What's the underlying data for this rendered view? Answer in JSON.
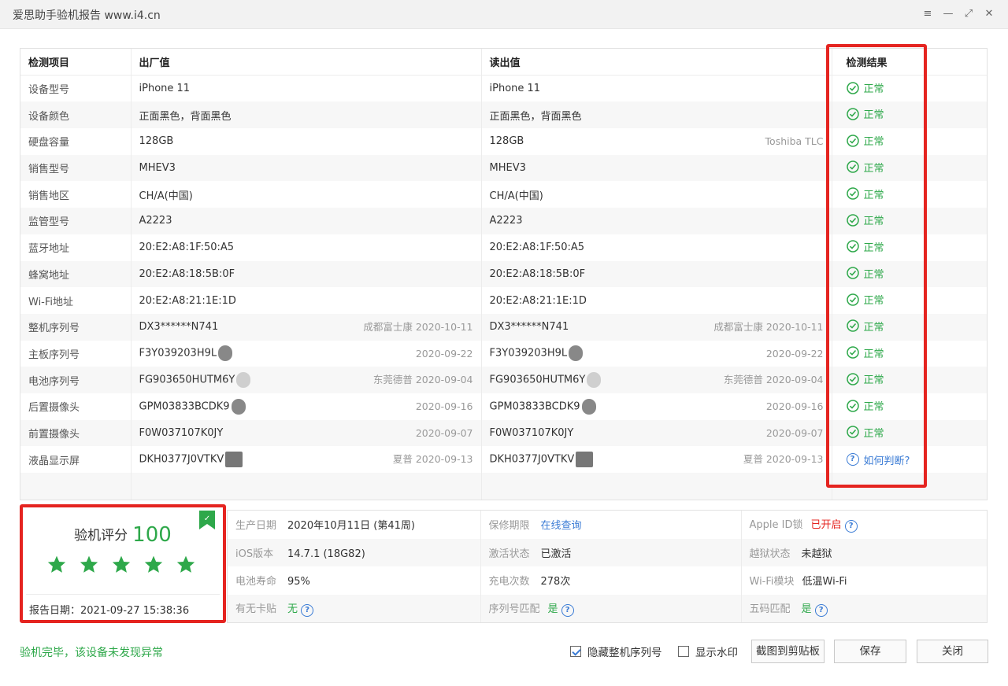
{
  "window": {
    "title": "爱思助手验机报告 www.i4.cn",
    "controls": [
      "≡",
      "—",
      "⤢",
      "✕"
    ]
  },
  "table": {
    "headers": {
      "item": "检测项目",
      "factory": "出厂值",
      "read": "读出值",
      "result": "检测结果"
    },
    "rows": [
      {
        "item": "设备型号",
        "factory": "iPhone 11",
        "factory_note": "",
        "read": "iPhone 11",
        "read_note": "",
        "result": "正常"
      },
      {
        "item": "设备颜色",
        "factory": "正面黑色，背面黑色",
        "factory_note": "",
        "read": "正面黑色，背面黑色",
        "read_note": "",
        "result": "正常"
      },
      {
        "item": "硬盘容量",
        "factory": "128GB",
        "factory_note": "",
        "read": "128GB",
        "read_note": "Toshiba TLC",
        "result": "正常"
      },
      {
        "item": "销售型号",
        "factory": "MHEV3",
        "factory_note": "",
        "read": "MHEV3",
        "read_note": "",
        "result": "正常"
      },
      {
        "item": "销售地区",
        "factory": "CH/A(中国)",
        "factory_note": "",
        "read": "CH/A(中国)",
        "read_note": "",
        "result": "正常"
      },
      {
        "item": "监管型号",
        "factory": "A2223",
        "factory_note": "",
        "read": "A2223",
        "read_note": "",
        "result": "正常"
      },
      {
        "item": "蓝牙地址",
        "factory": "20:E2:A8:1F:50:A5",
        "factory_note": "",
        "read": "20:E2:A8:1F:50:A5",
        "read_note": "",
        "result": "正常"
      },
      {
        "item": "蜂窝地址",
        "factory": "20:E2:A8:18:5B:0F",
        "factory_note": "",
        "read": "20:E2:A8:18:5B:0F",
        "read_note": "",
        "result": "正常"
      },
      {
        "item": "Wi-Fi地址",
        "factory": "20:E2:A8:21:1E:1D",
        "factory_note": "",
        "read": "20:E2:A8:21:1E:1D",
        "read_note": "",
        "result": "正常"
      },
      {
        "item": "整机序列号",
        "factory": "DX3******N741",
        "factory_note": "成都富士康 2020-10-11",
        "read": "DX3******N741",
        "read_note": "成都富士康 2020-10-11",
        "result": "正常"
      },
      {
        "item": "主板序列号",
        "factory": "F3Y039203H9L",
        "factory_note": "2020-09-22",
        "read": "F3Y039203H9L",
        "read_note": "2020-09-22",
        "result": "正常"
      },
      {
        "item": "电池序列号",
        "factory": "FG903650HUTM6Y",
        "factory_note": "东莞德普 2020-09-04",
        "read": "FG903650HUTM6Y",
        "read_note": "东莞德普 2020-09-04",
        "result": "正常"
      },
      {
        "item": "后置摄像头",
        "factory": "GPM03833BCDK9",
        "factory_note": "2020-09-16",
        "read": "GPM03833BCDK9",
        "read_note": "2020-09-16",
        "result": "正常"
      },
      {
        "item": "前置摄像头",
        "factory": "F0W037107K0JY",
        "factory_note": "2020-09-07",
        "read": "F0W037107K0JY",
        "read_note": "2020-09-07",
        "result": "正常"
      },
      {
        "item": "液晶显示屏",
        "factory": "DKH0377J0VTKV",
        "factory_note": "夏普 2020-09-13",
        "read": "DKH0377J0VTKV",
        "read_note": "夏普 2020-09-13",
        "result": "如何判断?"
      }
    ]
  },
  "score": {
    "label": "验机评分",
    "value": "100",
    "stars": 5,
    "date_label": "报告日期：",
    "date": "2021-09-27 15:38:36"
  },
  "info": {
    "rows": [
      [
        {
          "label": "生产日期",
          "value": "2020年10月11日 (第41周)"
        },
        {
          "label": "保修期限",
          "value": "在线查询"
        },
        {
          "label": "Apple ID锁",
          "value": "已开启"
        }
      ],
      [
        {
          "label": "iOS版本",
          "value": "14.7.1 (18G82)"
        },
        {
          "label": "激活状态",
          "value": "已激活"
        },
        {
          "label": "越狱状态",
          "value": "未越狱"
        }
      ],
      [
        {
          "label": "电池寿命",
          "value": "95%"
        },
        {
          "label": "充电次数",
          "value": "278次"
        },
        {
          "label": "Wi-Fi模块",
          "value": "低温Wi-Fi"
        }
      ],
      [
        {
          "label": "有无卡贴",
          "value": "无"
        },
        {
          "label": "序列号匹配",
          "value": "是"
        },
        {
          "label": "五码匹配",
          "value": "是"
        }
      ]
    ]
  },
  "footer": {
    "message": "验机完毕，该设备未发现异常",
    "hide_serial_label": "隐藏整机序列号",
    "hide_serial_checked": true,
    "watermark_label": "显示水印",
    "watermark_checked": false,
    "copy_button": "截图到剪贴板",
    "save_button": "保存",
    "close_button": "关闭"
  },
  "colors": {
    "accent_green": "#2ea84a",
    "highlight_red": "#e52420",
    "link_blue": "#3a7bd5"
  }
}
